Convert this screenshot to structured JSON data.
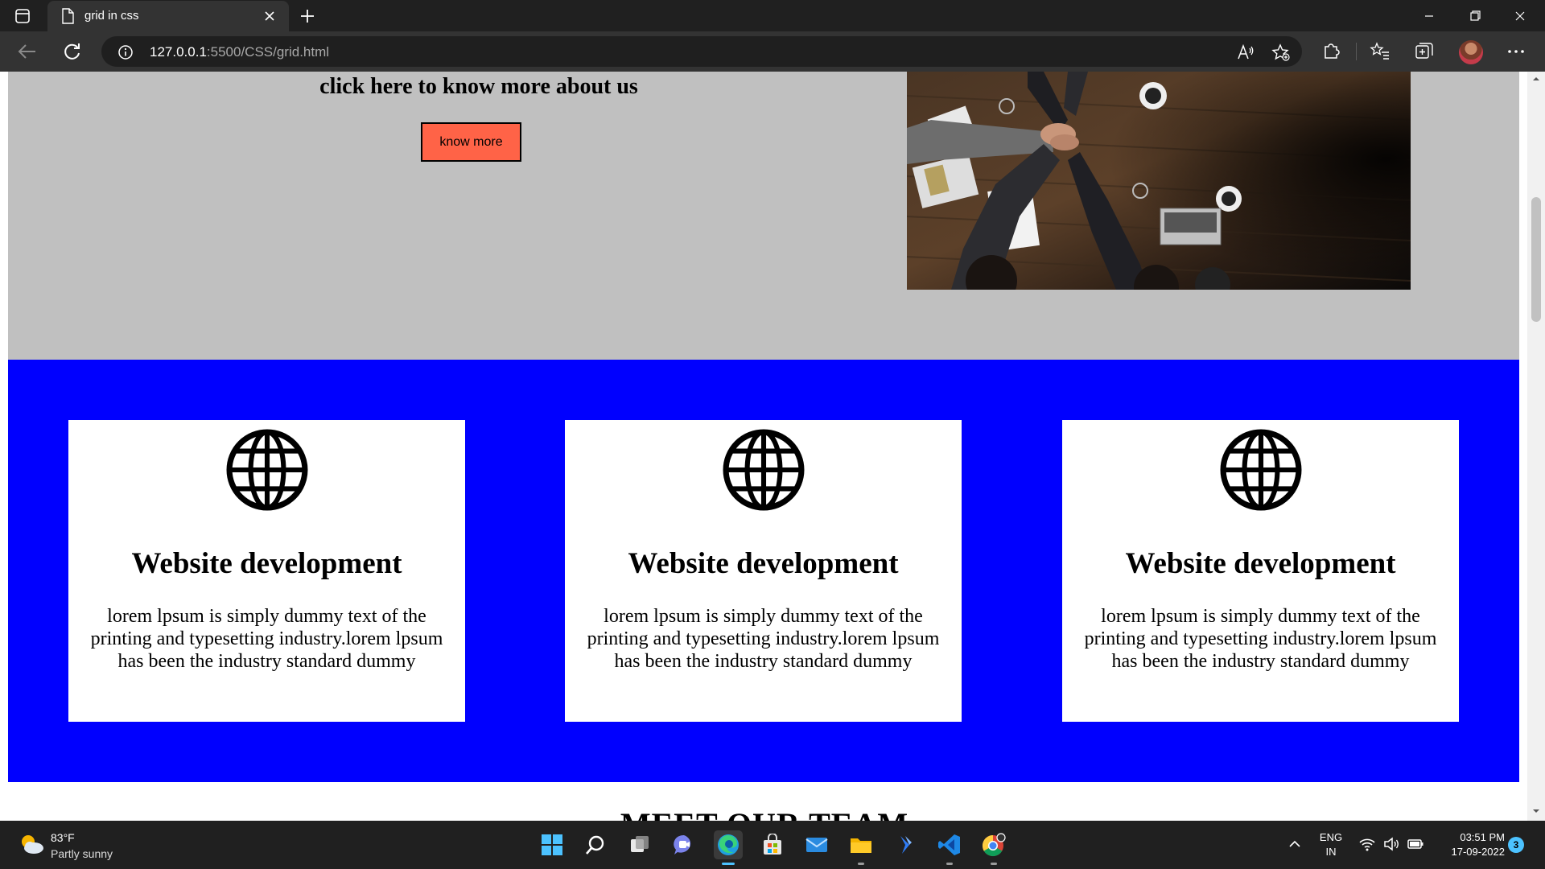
{
  "browser": {
    "tab_title": "grid in css",
    "url_host": "127.0.0.1",
    "url_path": ":5500/CSS/grid.html"
  },
  "page": {
    "about": {
      "heading": "click here to know more about us",
      "button_label": "know more"
    },
    "services": {
      "cards": [
        {
          "title": "Website development",
          "text": "lorem lpsum is simply dummy text of the printing and typesetting industry.lorem lpsum has been the industry standard dummy",
          "icon": "globe-icon"
        },
        {
          "title": "Website development",
          "text": "lorem lpsum is simply dummy text of the printing and typesetting industry.lorem lpsum has been the industry standard dummy",
          "icon": "globe-icon"
        },
        {
          "title": "Website development",
          "text": "lorem lpsum is simply dummy text of the printing and typesetting industry.lorem lpsum has been the industry standard dummy",
          "icon": "globe-icon"
        }
      ]
    },
    "team_heading": "MEET OUR TEAM"
  },
  "taskbar": {
    "weather_temp": "83°F",
    "weather_desc": "Partly sunny",
    "lang_line1": "ENG",
    "lang_line2": "IN",
    "time": "03:51 PM",
    "date": "17-09-2022",
    "notification_count": "3",
    "apps": [
      "start-icon",
      "search-icon",
      "task-view-icon",
      "teams-chat-icon",
      "edge-icon",
      "store-icon",
      "mail-icon",
      "file-explorer-icon",
      "power-automate-icon",
      "vscode-icon",
      "chrome-icon"
    ]
  },
  "colors": {
    "about_bg": "#c0c0c0",
    "button_bg": "#ff6347",
    "services_bg": "#0000ff",
    "card_bg": "#ffffff"
  }
}
